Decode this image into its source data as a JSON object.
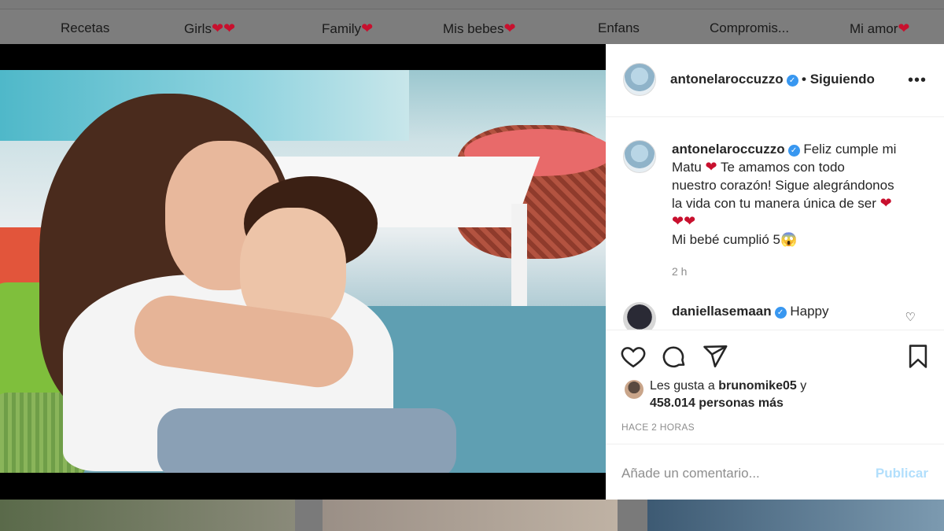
{
  "highlights": [
    {
      "label": "Recetas",
      "hearts": ""
    },
    {
      "label": "Girls",
      "hearts": "❤❤"
    },
    {
      "label": "Family",
      "hearts": "❤"
    },
    {
      "label": "Mis bebes",
      "hearts": "❤"
    },
    {
      "label": "Enfans",
      "hearts": ""
    },
    {
      "label": "Compromis...",
      "hearts": ""
    },
    {
      "label": "Mi amor",
      "hearts": "❤"
    }
  ],
  "post": {
    "username": "antonelaroccuzzo",
    "follow_status": "• Siguiendo",
    "more_label": "•••",
    "caption_line1": "Feliz cumple mi",
    "caption_line2a": "Matu",
    "caption_line2b": "Te amamos con todo",
    "caption_line3": "nuestro corazón! Sigue alegrándonos",
    "caption_line4": "la vida con tu manera única de ser",
    "caption_line5": "❤❤",
    "caption_line6": "Mi bebé cumplió 5😱",
    "caption_time": "2 h",
    "comment_user": "daniellasemaan",
    "comment_text": "Happy",
    "likes_prefix": "Les gusta a",
    "likes_user": "brunomike05",
    "likes_and": "y",
    "likes_count": "458.014 personas más",
    "posted_ago": "HACE 2 HORAS",
    "comment_placeholder": "Añade un comentario...",
    "publish_label": "Publicar"
  },
  "colors": {
    "verified": "#3897f0",
    "heart": "#c8102e",
    "publish": "#b2dffc"
  }
}
